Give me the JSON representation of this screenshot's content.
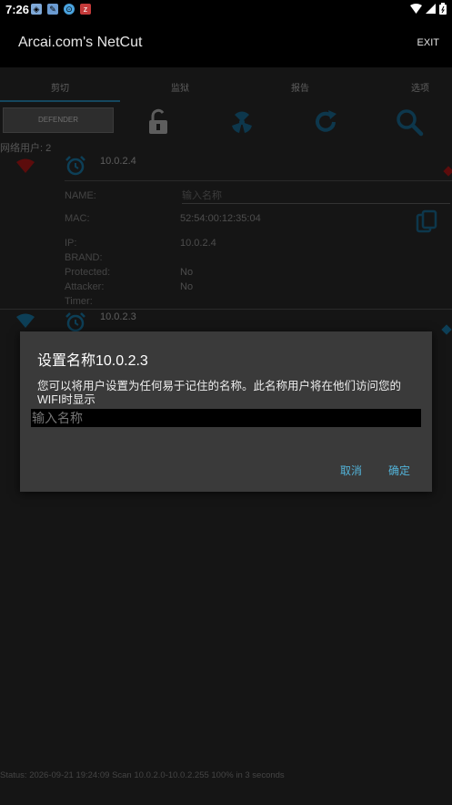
{
  "status_bar": {
    "time": "7:26"
  },
  "app": {
    "title": "Arcai.com's NetCut",
    "exit_label": "EXIT"
  },
  "tabs": [
    "剪切",
    "监狱",
    "报告",
    "选项"
  ],
  "toolbar": {
    "defender_label": "DEFENDER"
  },
  "device_count": "网络用户: 2",
  "devices": [
    {
      "ip_title": "10.0.2.4",
      "name_label": "NAME:",
      "name_placeholder": "输入名称",
      "mac_label": "MAC:",
      "mac": "52:54:00:12:35:04",
      "ip_label": "IP:",
      "ip": "10.0.2.4",
      "brand_label": "BRAND:",
      "protected_label": "Protected:",
      "protected": "No",
      "attacker_label": "Attacker:",
      "attacker": "No",
      "timer_label": "Timer:"
    },
    {
      "ip_title": "10.0.2.3"
    }
  ],
  "dialog": {
    "title": "设置名称10.0.2.3",
    "message": "您可以将用户设置为任何易于记住的名称。此名称用户将在他们访问您的WIFI时显示",
    "input_placeholder": "输入名称",
    "cancel": "取消",
    "ok": "确定"
  },
  "footer_status": "Status: 2026-09-21 19:24:09 Scan 10.0.2.0-10.0.2.255  100% in 3 seconds",
  "colors": {
    "accent": "#2a8fbd",
    "wifi_red": "#b81818",
    "dialog_bg": "#3a3a3a",
    "button_text": "#52b3d9"
  }
}
